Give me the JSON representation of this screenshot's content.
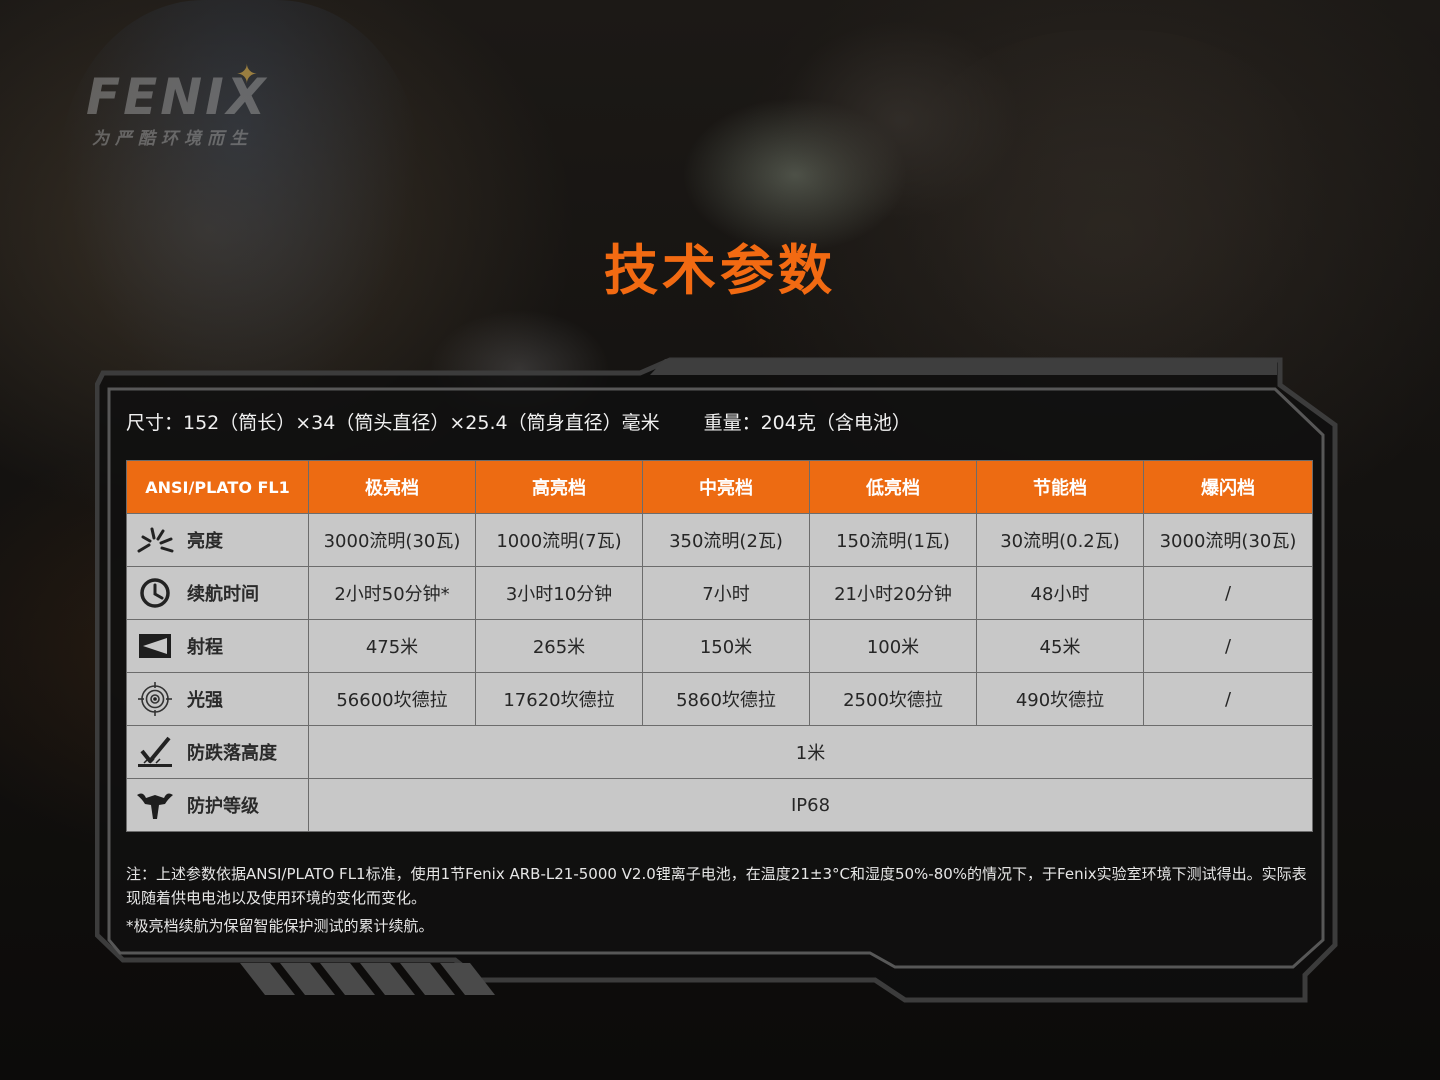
{
  "brand": {
    "logo_text": "FENIX",
    "slogan": "为严酷环境而生"
  },
  "title": "技术参数",
  "specs": {
    "dimensions": "尺寸：152（筒长）×34（筒头直径）×25.4（筒身直径）毫米",
    "weight": "重量：204克（含电池）"
  },
  "table": {
    "header": [
      "ANSI/PLATO FL1",
      "极亮档",
      "高亮档",
      "中亮档",
      "低亮档",
      "节能档",
      "爆闪档"
    ],
    "rows": [
      {
        "icon": "brightness-icon",
        "label": "亮度",
        "values": [
          "3000流明(30瓦)",
          "1000流明(7瓦)",
          "350流明(2瓦)",
          "150流明(1瓦)",
          "30流明(0.2瓦)",
          "3000流明(30瓦)"
        ]
      },
      {
        "icon": "clock-icon",
        "label": "续航时间",
        "values": [
          "2小时50分钟*",
          "3小时10分钟",
          "7小时",
          "21小时20分钟",
          "48小时",
          "/"
        ]
      },
      {
        "icon": "beam-distance-icon",
        "label": "射程",
        "values": [
          "475米",
          "265米",
          "150米",
          "100米",
          "45米",
          "/"
        ]
      },
      {
        "icon": "intensity-target-icon",
        "label": "光强",
        "values": [
          "56600坎德拉",
          "17620坎德拉",
          "5860坎德拉",
          "2500坎德拉",
          "490坎德拉",
          "/"
        ]
      }
    ],
    "impact": {
      "icon": "impact-drop-icon",
      "label": "防跌落高度",
      "value": "1米"
    },
    "waterproof": {
      "icon": "waterproof-icon",
      "label": "防护等级",
      "value": "IP68"
    }
  },
  "notes": {
    "note1": "注：上述参数依据ANSI/PLATO FL1标准，使用1节Fenix ARB-L21-5000 V2.0锂离子电池，在温度21±3°C和湿度50%-80%的情况下，于Fenix实验室环境下测试得出。实际表现随着供电电池以及使用环境的变化而变化。",
    "note2": "*极亮档续航为保留智能保护测试的累计续航。"
  },
  "colors": {
    "accent": "#ed6b12",
    "title": "#f26a12",
    "cell_bg": "#c8c8c8",
    "panel_border": "#4a4a4a"
  }
}
